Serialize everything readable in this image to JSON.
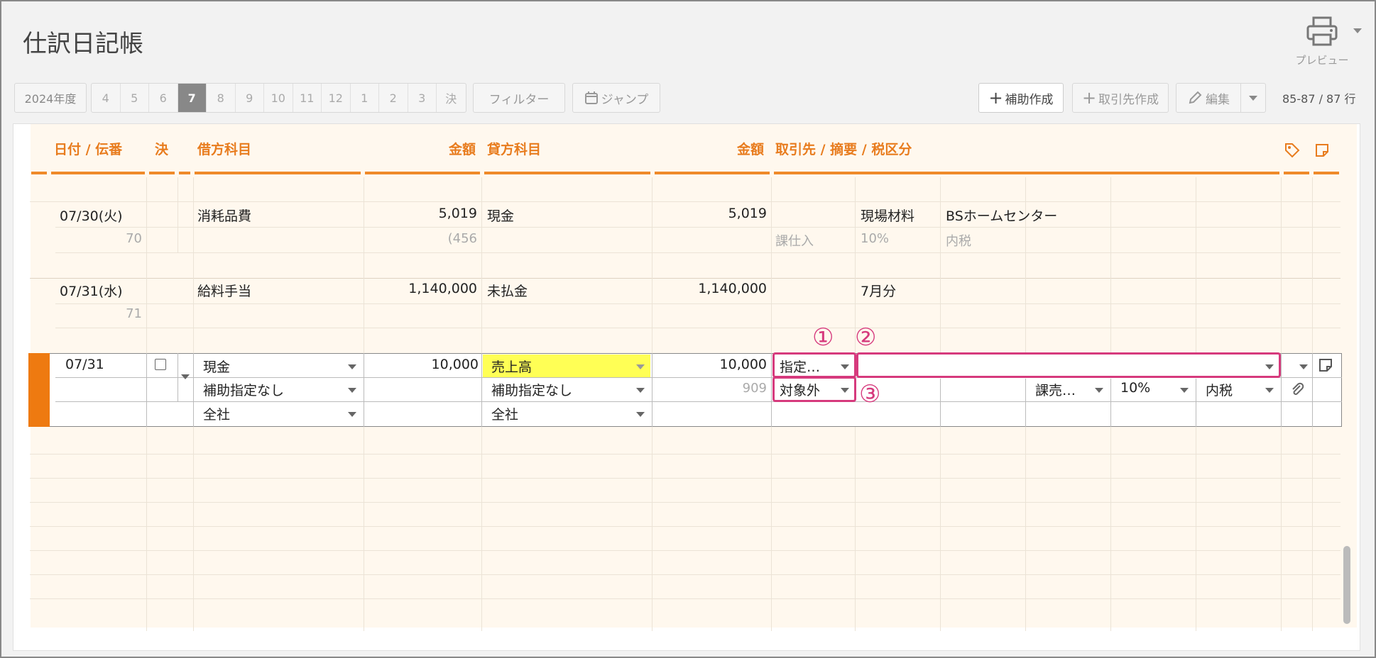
{
  "page": {
    "title": "仕訳日記帳"
  },
  "print": {
    "label": "プレビュー"
  },
  "toolbar": {
    "year": "2024年度",
    "months": [
      "4",
      "5",
      "6",
      "7",
      "8",
      "9",
      "10",
      "11",
      "12",
      "1",
      "2",
      "3",
      "決"
    ],
    "active_month": "7",
    "filter": "フィルター",
    "jump": "ジャンプ",
    "sub_create": "補助作成",
    "client_create": "取引先作成",
    "edit": "編集",
    "rows_count": "85-87 / 87 行"
  },
  "columns": {
    "date": "日付 / 伝番",
    "settle": "決",
    "debit_account": "借方科目",
    "debit_amount": "金額",
    "credit_account": "貸方科目",
    "credit_amount": "金額",
    "client_memo_tax": "取引先 / 摘要 / 税区分"
  },
  "rows": [
    {
      "date": "07/30(火)",
      "voucher": "70",
      "debit_account": "消耗品費",
      "debit_amount": "5,019",
      "debit_tax": "(456",
      "credit_account": "現金",
      "credit_amount": "5,019",
      "memo1": "現場材料",
      "memo2": "BSホームセンター",
      "tax_category": "課仕入",
      "tax_rate": "10%",
      "tax_type": "内税"
    },
    {
      "date": "07/31(水)",
      "voucher": "71",
      "debit_account": "給料手当",
      "debit_amount": "1,140,000",
      "credit_account": "未払金",
      "credit_amount": "1,140,000",
      "memo1": "7月分"
    }
  ],
  "edit_row": {
    "date": "07/31",
    "debit_account": "現金",
    "debit_sub": "補助指定なし",
    "debit_dept": "全社",
    "debit_amount": "10,000",
    "credit_account": "売上高",
    "credit_sub": "補助指定なし",
    "credit_dept": "全社",
    "credit_amount": "10,000",
    "credit_tax": "909",
    "client": "指定…",
    "tax_target": "対象外",
    "tax_category": "課売…",
    "tax_rate": "10%",
    "tax_type": "内税"
  },
  "annotations": [
    "①",
    "②",
    "③"
  ],
  "colors": {
    "accent": "#ef8a2a",
    "highlight": "#d63a7d",
    "yellow": "#ffff55"
  }
}
